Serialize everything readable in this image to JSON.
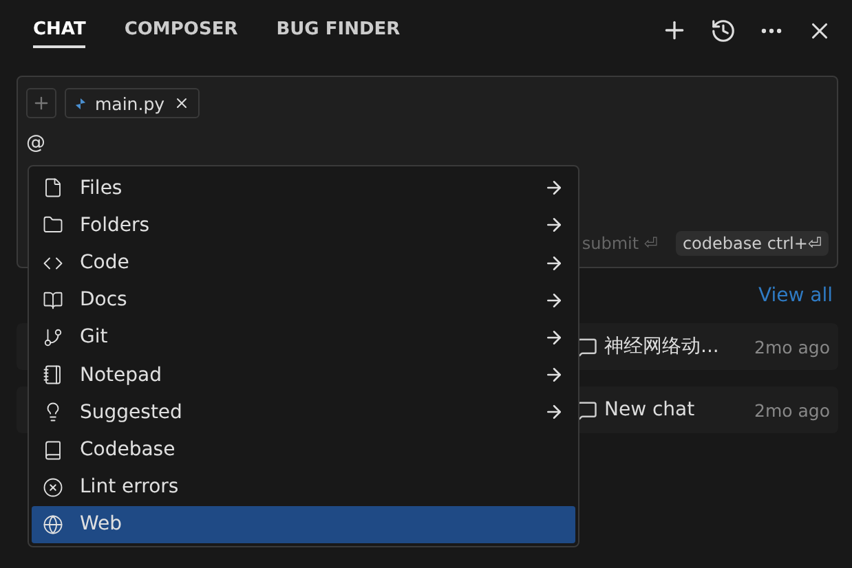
{
  "tabs": [
    {
      "label": "CHAT",
      "selected": true
    },
    {
      "label": "COMPOSER",
      "selected": false
    },
    {
      "label": "BUG FINDER",
      "selected": false
    }
  ],
  "composer": {
    "attachment": "main.py",
    "text": "@",
    "hints": [
      {
        "label": "submit ⏎",
        "kind": "plain"
      },
      {
        "label": "codebase ctrl+⏎",
        "kind": "chip"
      }
    ]
  },
  "mention_menu": [
    {
      "label": "Files",
      "submenu": true,
      "selected": false
    },
    {
      "label": "Folders",
      "submenu": true,
      "selected": false
    },
    {
      "label": "Code",
      "submenu": true,
      "selected": false
    },
    {
      "label": "Docs",
      "submenu": true,
      "selected": false
    },
    {
      "label": "Git",
      "submenu": true,
      "selected": false
    },
    {
      "label": "Notepad",
      "submenu": true,
      "selected": false
    },
    {
      "label": "Suggested",
      "submenu": true,
      "selected": false
    },
    {
      "label": "Codebase",
      "submenu": false,
      "selected": false
    },
    {
      "label": "Lint errors",
      "submenu": false,
      "selected": false
    },
    {
      "label": "Web",
      "submenu": false,
      "selected": true
    }
  ],
  "recent": {
    "view_all": "View all",
    "chats": [
      {
        "title": "神经网络动...",
        "time": "2mo ago"
      },
      {
        "title": "New chat",
        "time": "2mo ago"
      }
    ]
  }
}
